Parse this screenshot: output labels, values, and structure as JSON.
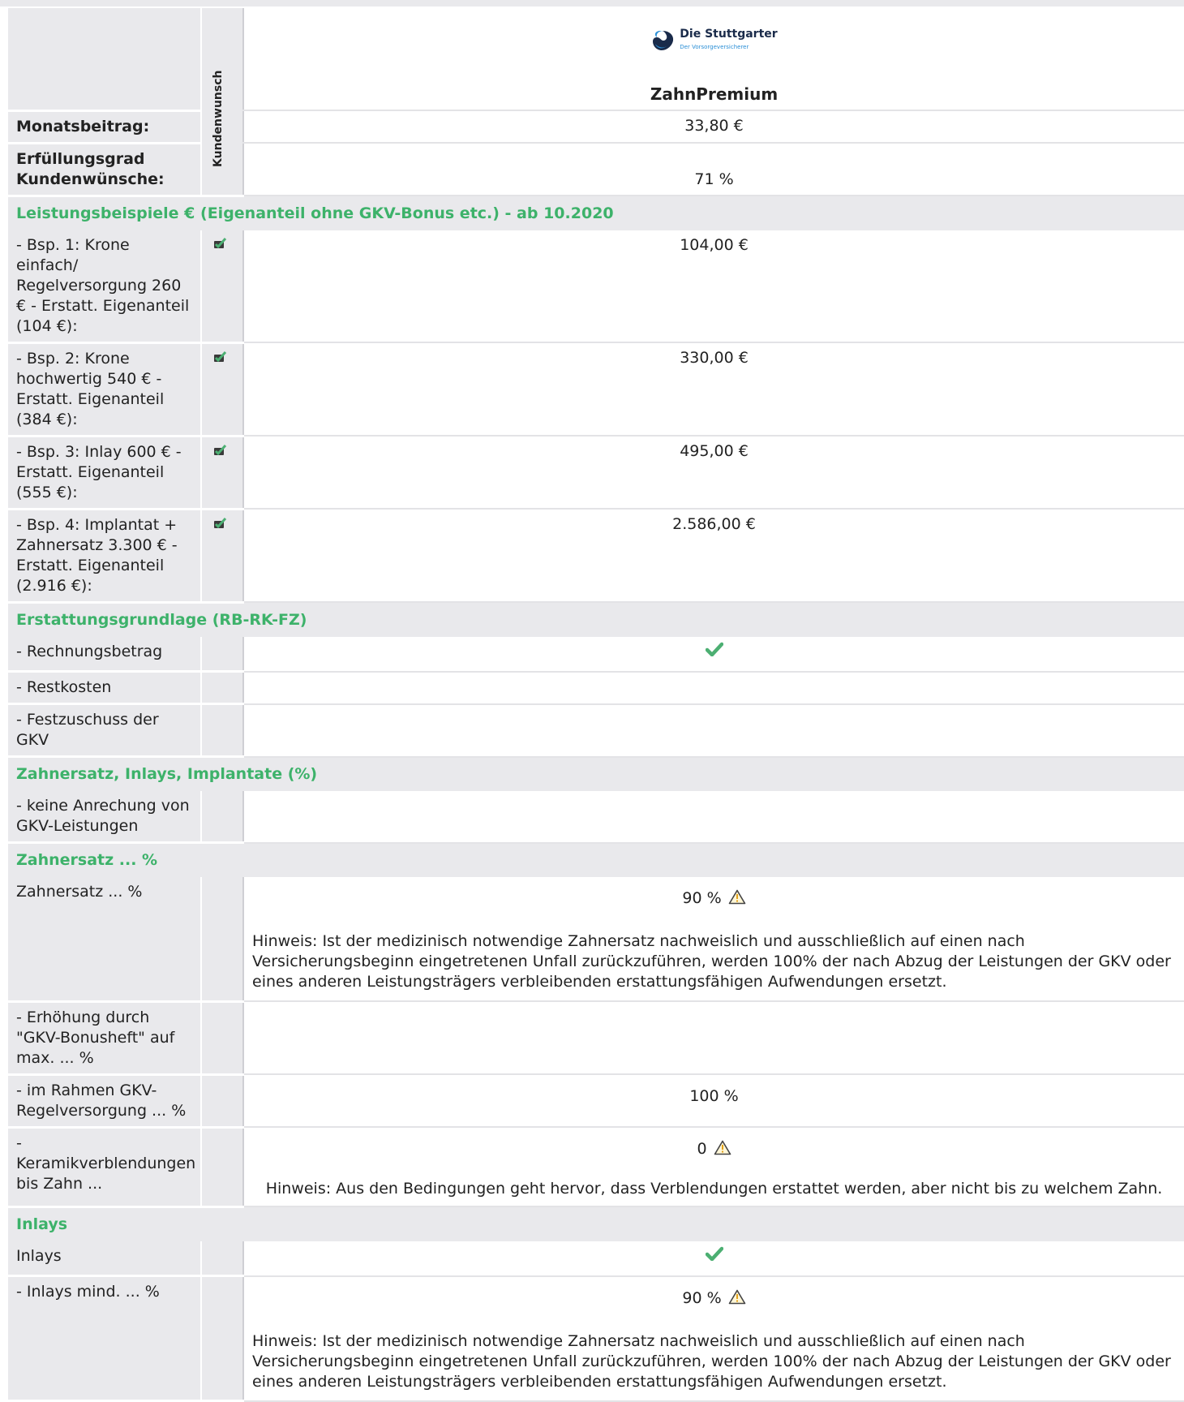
{
  "header": {
    "column_label": "Kundenwunsch",
    "logo": {
      "name": "Die Stuttgarter",
      "tagline": "Der Vorsorgeversicherer",
      "icon": "die-stuttgarter-logo-icon"
    },
    "product": "ZahnPremium"
  },
  "summary": {
    "beitrag_label": "Monatsbeitrag:",
    "beitrag_value": "33,80  €",
    "erfuellung_label_1": "Erfüllungsgrad",
    "erfuellung_label_2": "Kundenwünsche:",
    "erfuellung_value": "71  %"
  },
  "sections": {
    "leistung": "Leistungsbeispiele € (Eigenanteil ohne GKV-Bonus etc.) - ab 10.2020",
    "erstattung": "Erstattungsgrundlage (RB-RK-FZ)",
    "zahnersatz_inlays": "Zahnersatz, Inlays, Implantate (%)",
    "zahnersatz": "Zahnersatz ... %",
    "inlays": "Inlays"
  },
  "leistung_rows": [
    {
      "label": "- Bsp. 1: Krone einfach/ Regelversorgung 260 € - Erstatt. Eigenanteil (104 €):",
      "value": "104,00  €"
    },
    {
      "label": "- Bsp. 2: Krone hochwertig 540 € - Erstatt. Eigenanteil (384 €):",
      "value": "330,00  €"
    },
    {
      "label": "- Bsp. 3: Inlay 600 € - Erstatt. Eigenanteil (555 €):",
      "value": "495,00  €"
    },
    {
      "label": "- Bsp. 4: Implantat + Zahnersatz 3.300 € - Erstatt. Eigenanteil (2.916 €):",
      "value": "2.586,00  €"
    }
  ],
  "erstattung_rows": [
    {
      "label": "- Rechnungsbetrag",
      "checked": true
    },
    {
      "label": "- Restkosten"
    },
    {
      "label": "- Festzuschuss der GKV"
    }
  ],
  "zi_rows": [
    {
      "label": "- keine Anrechung von GKV-Leistungen"
    }
  ],
  "zahnersatz_rows": [
    {
      "label": "Zahnersatz ... %",
      "value": "90  %",
      "hint": "Hinweis: Ist der medizinisch notwendige Zahnersatz nachweislich und ausschließlich auf einen nach Versicherungsbeginn eingetretenen Unfall zurückzuführen, werden 100% der nach Abzug der Leistungen der GKV oder eines anderen Leistungsträgers verbleibenden erstattungsfähigen Aufwendungen ersetzt."
    },
    {
      "label": "- Erhöhung durch \"GKV-Bonusheft\" auf max. ... %"
    },
    {
      "label": "- im Rahmen GKV-Regelversorgung ... %",
      "value": "100  %"
    },
    {
      "label": "- Keramikverblendungen bis Zahn ...",
      "value": "0",
      "hint": "Hinweis: Aus den Bedingungen geht hervor, dass Verblendungen erstattet werden, aber nicht bis zu welchem Zahn."
    }
  ],
  "inlays_rows": [
    {
      "label": "Inlays",
      "checked": true
    },
    {
      "label": "- Inlays mind. ... %",
      "value": "90  %",
      "hint": "Hinweis: Ist der medizinisch notwendige Zahnersatz nachweislich und ausschließlich auf einen nach Versicherungsbeginn eingetretenen Unfall zurückzuführen, werden 100% der nach Abzug der Leistungen der GKV oder eines anderen Leistungsträgers verbleibenden erstattungsfähigen Aufwendungen ersetzt."
    }
  ],
  "icons": {
    "check": "check-icon",
    "warning": "warning-icon",
    "edit": "edit-check-icon"
  },
  "colors": {
    "section_text": "#3db26a",
    "check": "#4caf72",
    "band": "#e9e9ec",
    "warning": "#e3a21a"
  }
}
